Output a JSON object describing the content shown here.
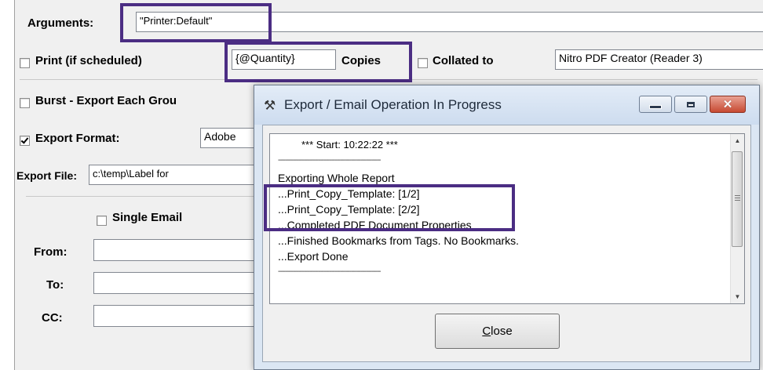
{
  "form": {
    "arguments_label": "Arguments:",
    "arguments_value": "\"Printer:Default\"",
    "print_label": "Print (if scheduled)",
    "quantity_value": "{@Quantity}",
    "copies_label": "Copies",
    "collated_label": "Collated to",
    "printer_value": "Nitro PDF Creator (Reader 3)",
    "burst_label": "Burst - Export Each Grou",
    "export_format_label": "Export Format:",
    "export_format_value": "Adobe",
    "export_file_label": "Export File:",
    "export_file_value": "c:\\temp\\Label for",
    "single_email_label": "Single Email",
    "from_label": "From:",
    "to_label": "To:",
    "cc_label": "CC:",
    "print_checked": false,
    "collated_checked": false,
    "burst_checked": false,
    "export_format_checked": true,
    "single_email_checked": false
  },
  "dialog": {
    "title": "Export / Email Operation In Progress",
    "app_icon": "tools-icon",
    "log": {
      "start": "*** Start: 10:22:22 ***",
      "dashes": "--------------------------------------------------------",
      "lines": [
        "Exporting Whole Report",
        "...Print_Copy_Template: [1/2]",
        "...Print_Copy_Template: [2/2]",
        "...Completed PDF Document Properties",
        "...Finished Bookmarks from Tags. No Bookmarks.",
        "...Export Done"
      ]
    },
    "close_button": {
      "accel": "C",
      "rest": "lose"
    }
  },
  "colors": {
    "highlight": "#4b2d83",
    "window_frame": "#dbe6f3",
    "close_red": "#c74a32"
  }
}
